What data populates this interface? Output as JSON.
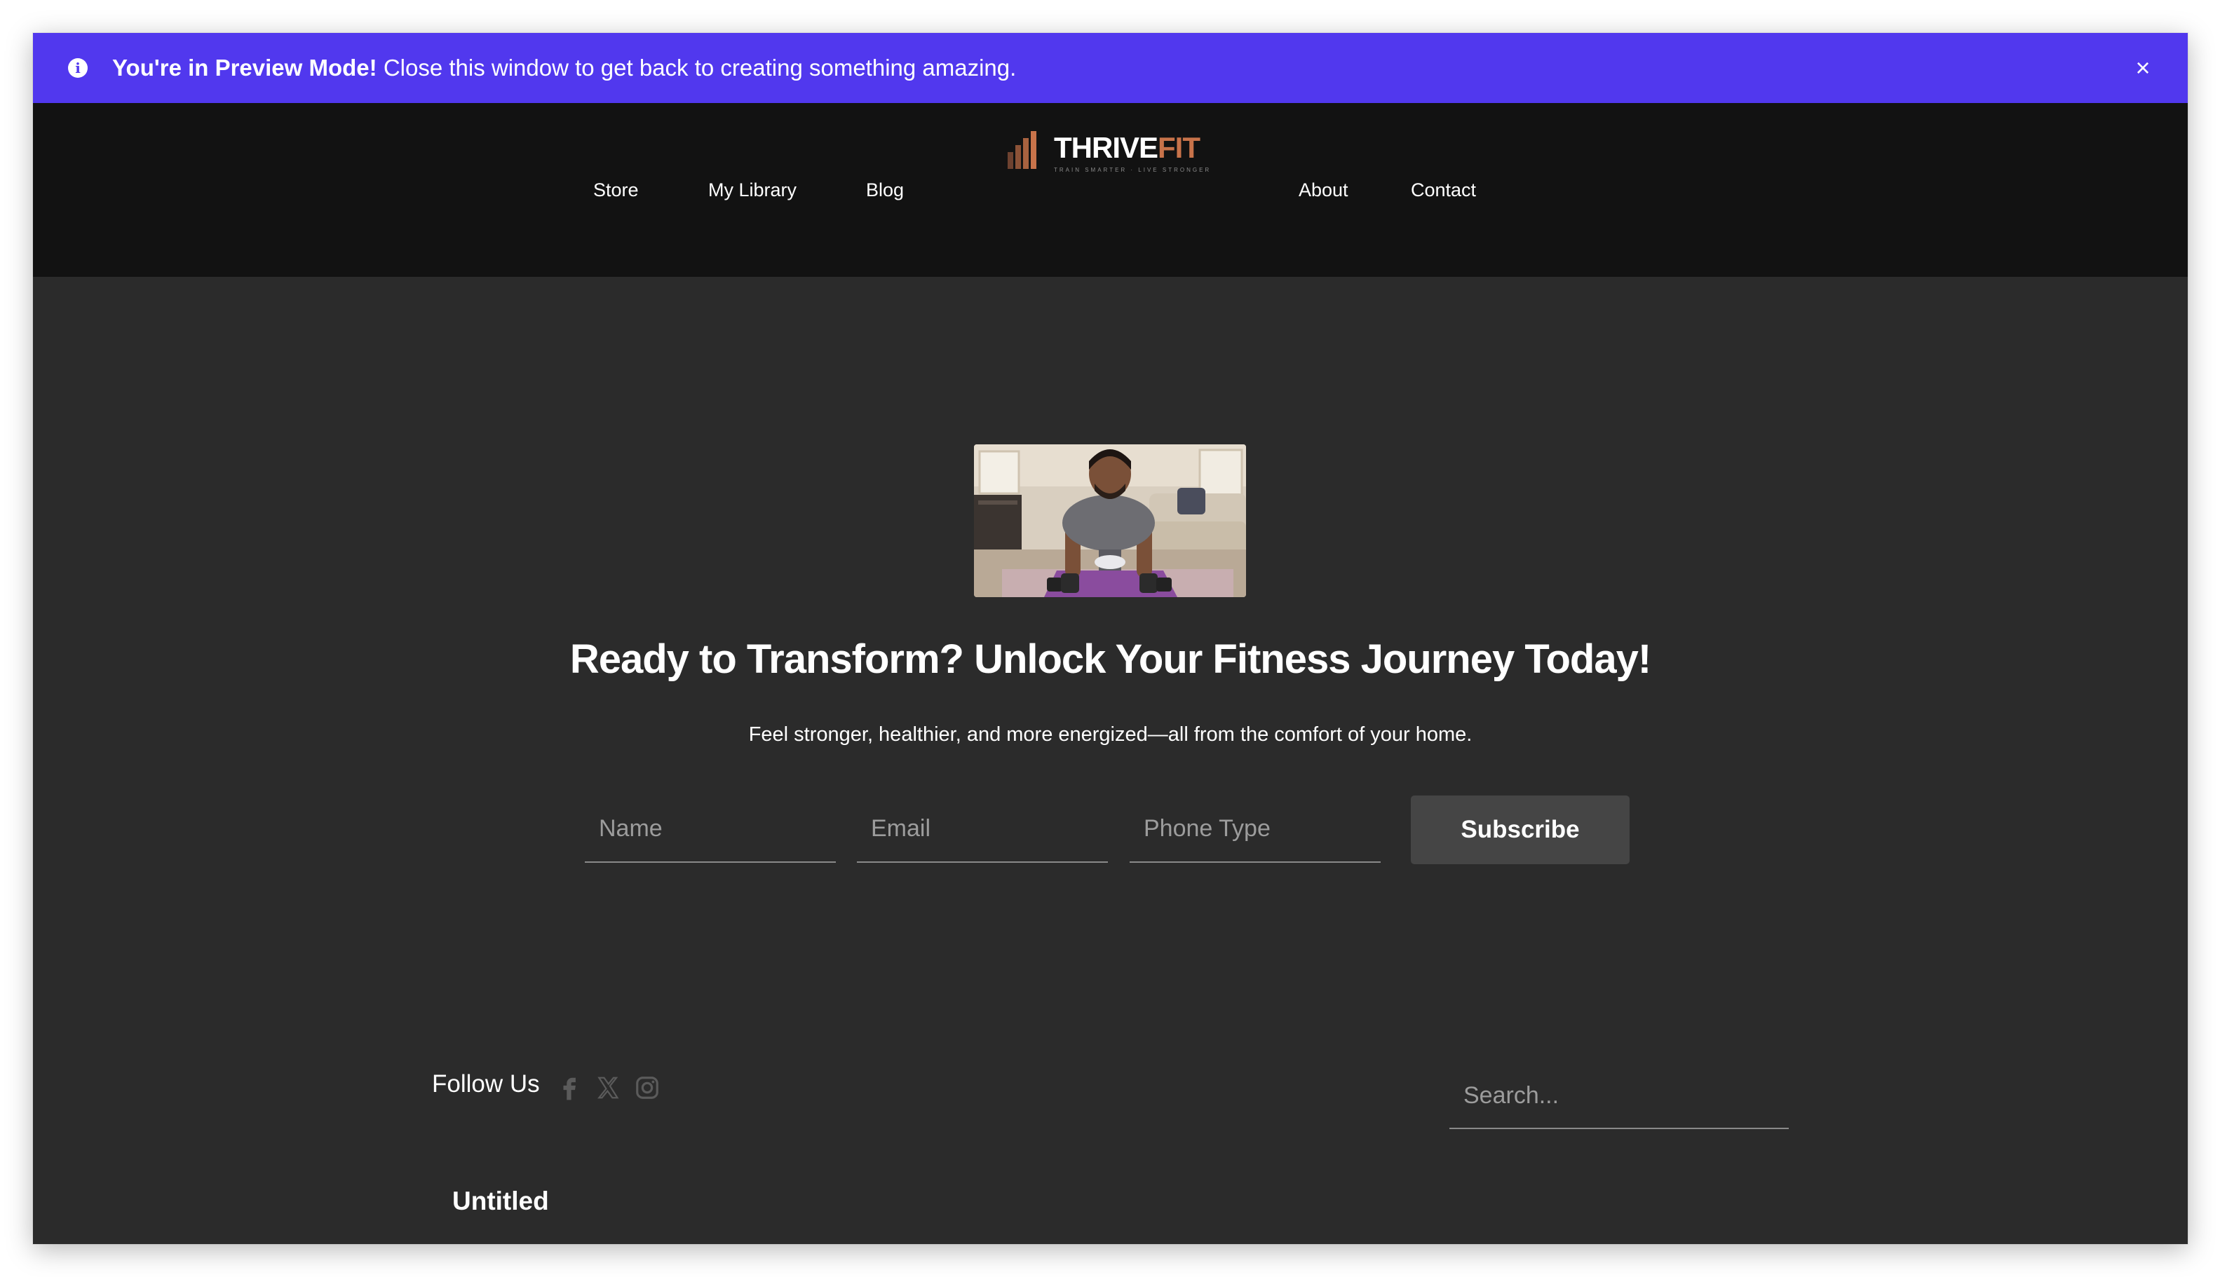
{
  "banner": {
    "bold_text": "You're in Preview Mode!",
    "text": " Close this window to get back to creating something amazing.",
    "icon": "info-icon",
    "close_icon": "close-icon",
    "background": "#5138ee"
  },
  "nav": {
    "left": [
      "Store",
      "My Library",
      "Blog"
    ],
    "right": [
      "About",
      "Contact"
    ]
  },
  "logo": {
    "part1": "THRIVE",
    "part2": "FIT",
    "tagline": "TRAIN SMARTER · LIVE STRONGER",
    "accent": "#c8734a"
  },
  "hero": {
    "image_alt": "Man doing push-ups on a purple yoga mat in a living room",
    "title": "Ready to Transform? Unlock Your Fitness Journey Today!",
    "subtitle": "Feel stronger, healthier, and more energized—all from the comfort of your home."
  },
  "form": {
    "name_placeholder": "Name",
    "email_placeholder": "Email",
    "phone_placeholder": "Phone Type",
    "subscribe_label": "Subscribe"
  },
  "footer": {
    "follow_label": "Follow Us",
    "social_icons": [
      "facebook-icon",
      "x-icon",
      "instagram-icon"
    ],
    "search_placeholder": "Search...",
    "untitled_label": "Untitled"
  }
}
